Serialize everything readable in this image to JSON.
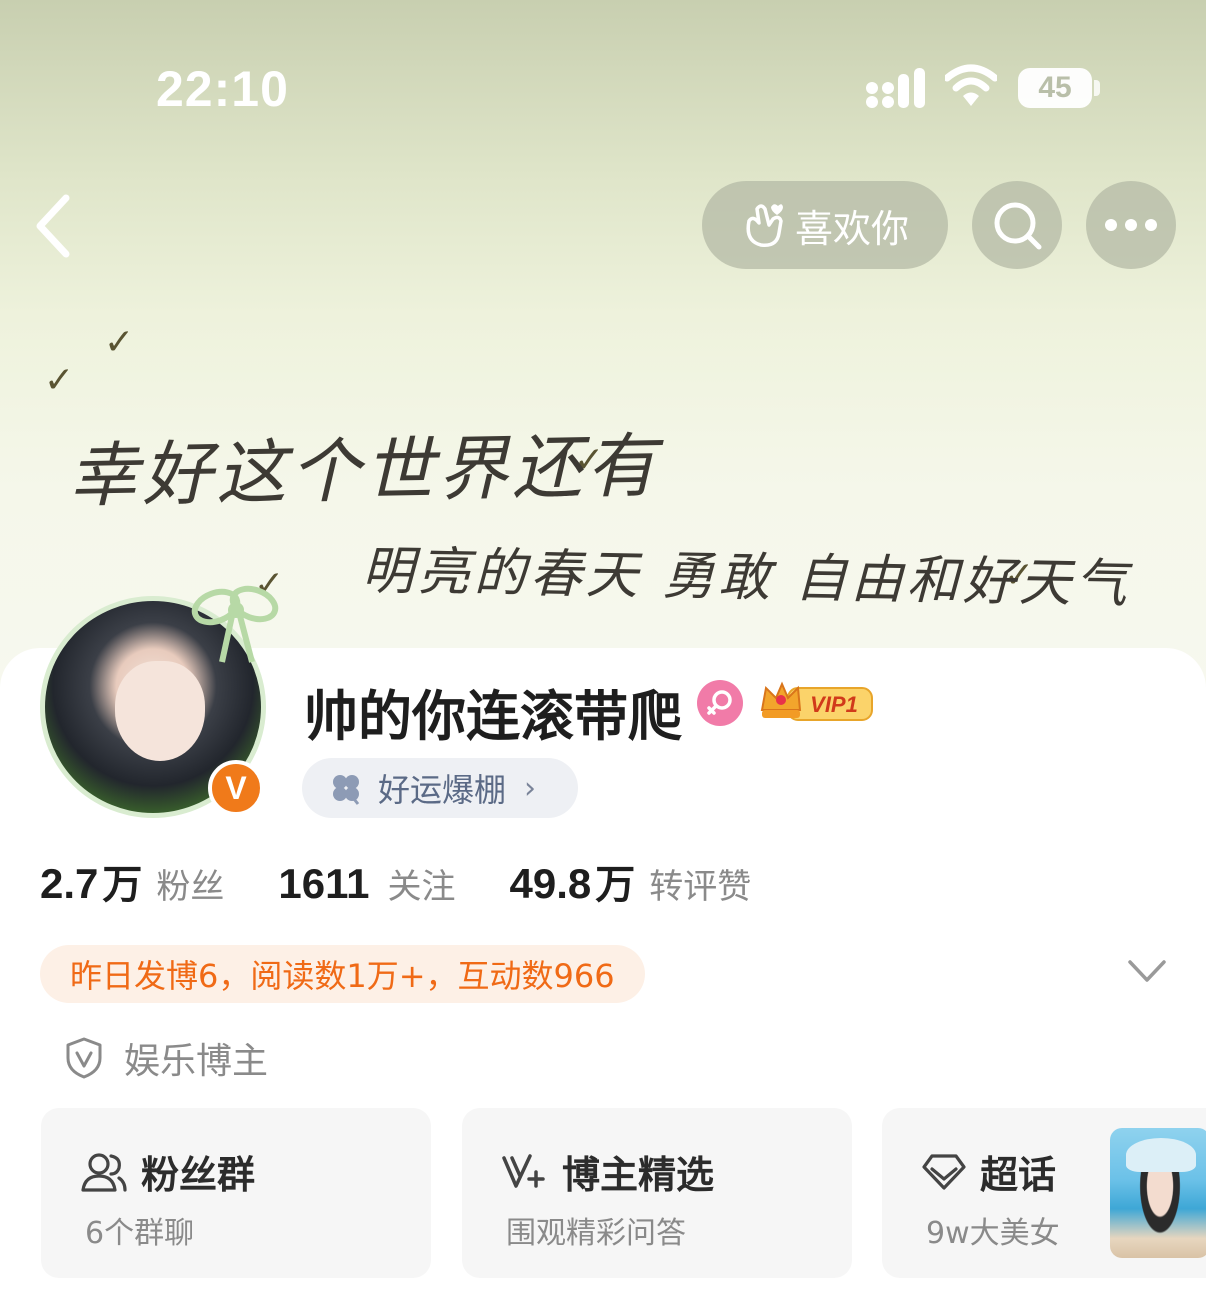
{
  "status_bar": {
    "time": "22:10",
    "battery": "45",
    "icons": [
      "signal-icon",
      "wifi-icon",
      "battery-icon"
    ]
  },
  "header": {
    "back_icon": "chevron-left-icon",
    "like_label": "喜欢你",
    "like_icon": "finger-heart-icon",
    "search_icon": "search-icon",
    "more_icon": "more-dots-icon"
  },
  "banner": {
    "line1": "幸好这个世界还有",
    "line2": "明亮的春天 勇敢 自由和好天气"
  },
  "profile": {
    "username": "帅的你连滚带爬",
    "gender_icon": "female-icon",
    "vip_label": "VIP1",
    "verified_icon": "verified-v-icon",
    "lucky_tag": "好运爆棚",
    "lucky_icon": "clover-icon"
  },
  "stats": [
    {
      "num": "2.7",
      "unit": "万",
      "label": "粉丝"
    },
    {
      "num": "1611",
      "unit": "",
      "label": "关注"
    },
    {
      "num": "49.8",
      "unit": "万",
      "label": "转评赞"
    }
  ],
  "activity": "昨日发博6，阅读数1万+，互动数966",
  "category": "娱乐博主",
  "features": [
    {
      "title": "粉丝群",
      "sub": "6个群聊",
      "icon": "fan-group-icon"
    },
    {
      "title": "博主精选",
      "sub": "围观精彩问答",
      "icon": "v-plus-icon"
    },
    {
      "title": "超话",
      "sub": "9w大美女",
      "icon": "diamond-icon"
    }
  ],
  "colors": {
    "accent_orange": "#f06a16",
    "activity_bg": "#fdf0e6",
    "tag_bg": "#eef0f4",
    "pink": "#f17ba8"
  }
}
